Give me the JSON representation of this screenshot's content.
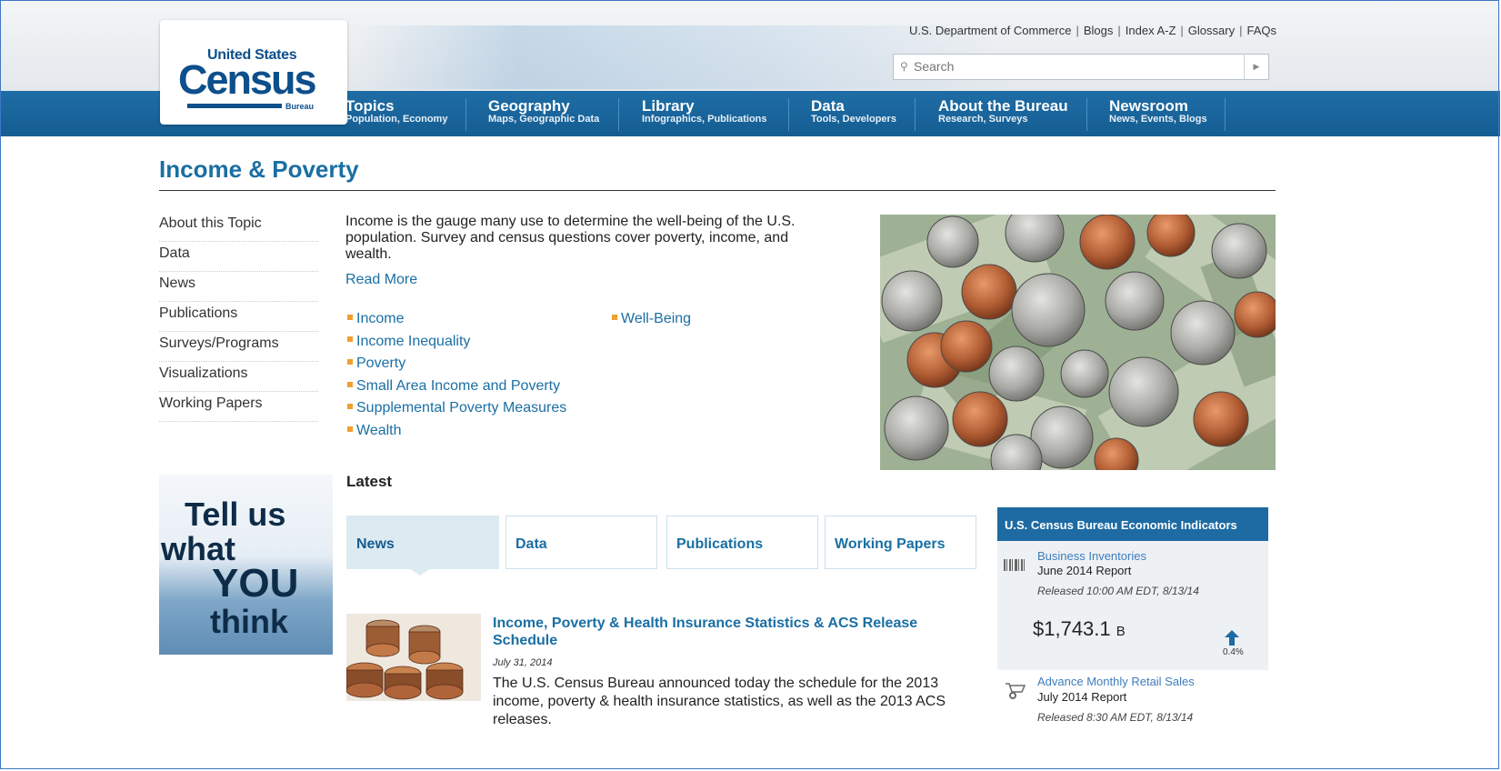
{
  "header": {
    "top_links": [
      "U.S. Department of Commerce",
      "Blogs",
      "Index A-Z",
      "Glossary",
      "FAQs"
    ],
    "search_placeholder": "Search",
    "logo": {
      "line1": "United States",
      "line2": "Census",
      "line3": "Bureau"
    }
  },
  "nav": [
    {
      "title": "Topics",
      "sub": "Population, Economy"
    },
    {
      "title": "Geography",
      "sub": "Maps, Geographic Data"
    },
    {
      "title": "Library",
      "sub": "Infographics, Publications"
    },
    {
      "title": "Data",
      "sub": "Tools, Developers"
    },
    {
      "title": "About the Bureau",
      "sub": "Research, Surveys"
    },
    {
      "title": "Newsroom",
      "sub": "News, Events, Blogs"
    }
  ],
  "page": {
    "title": "Income & Poverty",
    "intro": "Income is the gauge many use to determine the well-being of the U.S. population. Survey and census questions cover poverty, income, and wealth.",
    "read_more": "Read More"
  },
  "sidebar": [
    "About this Topic",
    "Data",
    "News",
    "Publications",
    "Surveys/Programs",
    "Visualizations",
    "Working Papers"
  ],
  "topics": {
    "col1": [
      "Income",
      "Income Inequality",
      "Poverty",
      "Small Area Income and Poverty",
      "Supplemental Poverty Measures",
      "Wealth"
    ],
    "col2": [
      "Well-Being"
    ]
  },
  "promo": {
    "line1": "Tell us",
    "line2": "what",
    "line3": "YOU",
    "line4": "think"
  },
  "latest": {
    "heading": "Latest",
    "tabs": [
      "News",
      "Data",
      "Publications",
      "Working Papers"
    ],
    "news": {
      "title": "Income, Poverty & Health Insurance Statistics & ACS Release Schedule",
      "date": "July 31, 2014",
      "body": "The U.S. Census Bureau announced today the schedule for the 2013 income, poverty & health insurance statistics, as well as the 2013 ACS releases."
    }
  },
  "indicators": {
    "header": "U.S. Census Bureau Economic Indicators",
    "items": [
      {
        "name": "Business Inventories",
        "report": "June 2014 Report",
        "released": "Released 10:00 AM EDT, 8/13/14",
        "value": "$1,743.1",
        "unit": "B",
        "change": "0.4%"
      },
      {
        "name": "Advance Monthly Retail Sales",
        "report": "July 2014 Report",
        "released": "Released 8:30 AM EDT, 8/13/14"
      }
    ]
  }
}
